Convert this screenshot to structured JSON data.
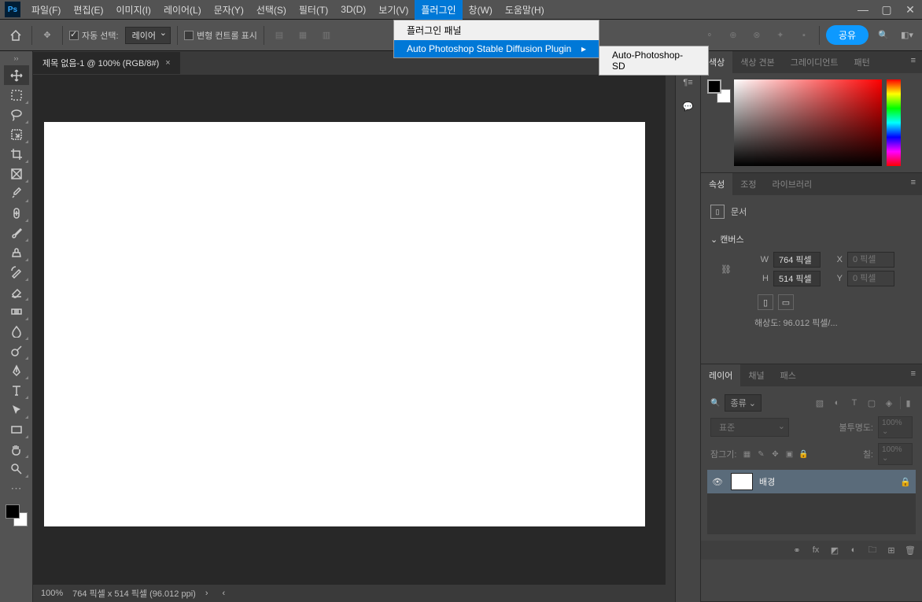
{
  "menubar": {
    "items": [
      "파일(F)",
      "편집(E)",
      "이미지(I)",
      "레이어(L)",
      "문자(Y)",
      "선택(S)",
      "필터(T)",
      "3D(D)",
      "보기(V)",
      "플러그인",
      "창(W)",
      "도움말(H)"
    ]
  },
  "dropdown": {
    "item0": "플러그인 패널",
    "item1": "Auto Photoshop Stable Diffusion Plugin",
    "sub0": "Auto-Photoshop-SD"
  },
  "optbar": {
    "auto_select": "자동 선택:",
    "auto_select_val": "레이어",
    "transform_controls": "변형 컨트롤 표시",
    "share": "공유"
  },
  "document": {
    "tab_title": "제목 없음-1 @ 100% (RGB/8#)",
    "zoom": "100%",
    "status": "764 픽셀 x 514 픽셀 (96.012 ppi)"
  },
  "panels": {
    "color": {
      "t0": "색상",
      "t1": "색상 견본",
      "t2": "그레이디언트",
      "t3": "패턴"
    },
    "props": {
      "t0": "속성",
      "t1": "조정",
      "t2": "라이브러리",
      "doc": "문서",
      "canvas": "캔버스",
      "w": "W",
      "h": "H",
      "x": "X",
      "y": "Y",
      "wval": "764 픽셀",
      "hval": "514 픽셀",
      "xph": "0 픽셀",
      "yph": "0 픽셀",
      "reso": "해상도: 96.012 픽셀/..."
    },
    "layers": {
      "t0": "레이어",
      "t1": "채널",
      "t2": "패스",
      "filter": "종류",
      "blend": "표준",
      "opacity_label": "불투명도:",
      "opacity_val": "100%",
      "lock_label": "잠그기:",
      "fill_label": "칠:",
      "fill_val": "100%",
      "bg_layer": "배경"
    }
  }
}
